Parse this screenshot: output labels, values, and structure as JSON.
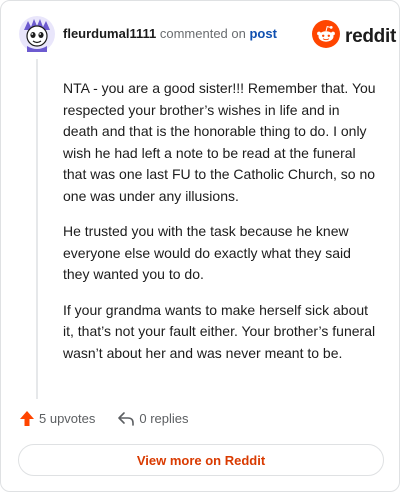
{
  "header": {
    "username": "fleurdumal1111",
    "connector": "commented on",
    "post_link": "post",
    "brand": "reddit",
    "avatar_icon": "snoo-avatar-icon",
    "brand_icon": "reddit-alien-icon"
  },
  "comment": {
    "paragraphs": [
      "NTA - you are a good sister!!! Remember that. You respected your brother’s wishes in life and in death and that is the honorable thing to do. I only wish he had left a note to be read at the funeral that was one last FU to the Catholic Church, so no one was under any illusions.",
      "He trusted you with the task because he knew everyone else would do exactly what they said they wanted you to do.",
      "If your grandma wants to make herself sick about it, that’s not your fault either. Your brother’s funeral wasn’t about her and was never meant to be."
    ]
  },
  "actions": {
    "upvotes_label": "5 upvotes",
    "upvote_icon": "upvote-arrow-icon",
    "replies_label": "0 replies",
    "reply_icon": "reply-arrow-icon"
  },
  "footer": {
    "view_more_label": "View more on Reddit"
  },
  "colors": {
    "brand_orange": "#ff4500",
    "link_blue": "#0f4fb0",
    "cta_orange": "#d93a00",
    "avatar_purple": "#6d5bd0"
  }
}
